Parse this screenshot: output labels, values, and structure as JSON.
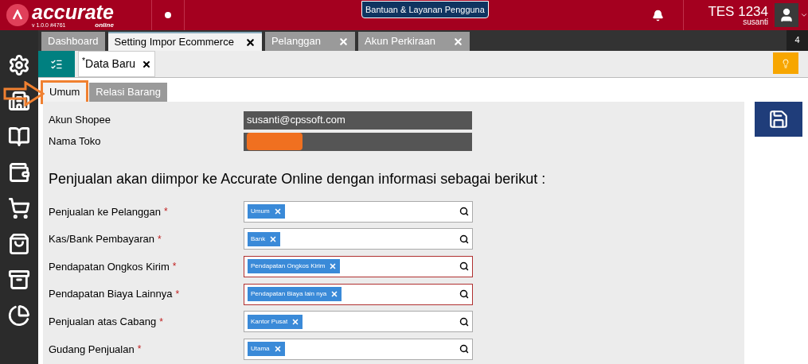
{
  "header": {
    "logo": "accurate",
    "logo_sub": "online",
    "version": "v 1.0.0 #4761",
    "help_button": "Bantuan & Layanan Pengguna",
    "company": "TES 1234",
    "user": "susanti"
  },
  "tabs": [
    {
      "label": "Dashboard",
      "selected": false,
      "closable": false
    },
    {
      "label": "Setting Impor Ecommerce",
      "selected": true,
      "closable": true
    },
    {
      "label": "Pelanggan",
      "selected": false,
      "closable": true
    },
    {
      "label": "Akun Perkiraan",
      "selected": false,
      "closable": true
    }
  ],
  "tab_count": "4",
  "document_tab": "$^{*}$Data Baru",
  "sub_tabs": [
    {
      "label": "Umum",
      "selected": true,
      "highlighted": true
    },
    {
      "label": "Relasi Barang",
      "selected": false,
      "highlighted": false
    }
  ],
  "info_fields": [
    {
      "label": "Akun Shopee",
      "value": "susanti@cpssoft.com",
      "redacted": false
    },
    {
      "label": "Nama Toko",
      "redacted": true
    }
  ],
  "heading": "Penjualan akan diimpor ke Accurate Online dengan informasi sebagai berikut :",
  "fields": [
    {
      "label": "Penjualan ke Pelanggan",
      "required_mark": "*",
      "invalid": false,
      "tag": "Umum"
    },
    {
      "label": "Kas/Bank Pembayaran",
      "required_mark": "*",
      "invalid": false,
      "tag": "Bank"
    },
    {
      "label": "Pendapatan Ongkos Kirim",
      "required_mark": "*",
      "invalid": true,
      "tag": "Pendapatan Ongkos Kirim"
    },
    {
      "label": "Pendapatan Biaya Lainnya",
      "required_mark": "*",
      "invalid": true,
      "tag": "Pendapatan Biaya lain nya"
    },
    {
      "label": "Penjualan atas Cabang",
      "required_mark": "*",
      "invalid": false,
      "tag": "Kantor Pusat"
    },
    {
      "label": "Gudang Penjualan",
      "required_mark": "*",
      "invalid": false,
      "tag": "Utama"
    }
  ]
}
